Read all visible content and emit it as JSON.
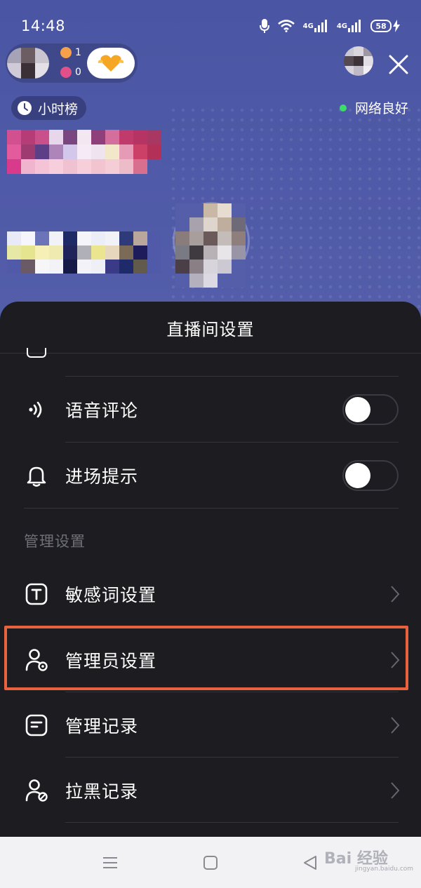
{
  "status_bar": {
    "time": "14:48",
    "network_1": "4G",
    "network_2": "4G",
    "battery": "58"
  },
  "host": {
    "stat_1": "1",
    "stat_2": "0"
  },
  "rank_badge": "小时榜",
  "network_status": "网络良好",
  "sheet": {
    "title": "直播间设置",
    "rows": [
      {
        "label": "语音评论",
        "icon": "voice-icon",
        "toggle": false
      },
      {
        "label": "进场提示",
        "icon": "bell-icon",
        "toggle": false
      }
    ],
    "section_label": "管理设置",
    "manage_items": [
      {
        "label": "敏感词设置",
        "icon": "text-icon"
      },
      {
        "label": "管理员设置",
        "icon": "admin-icon"
      },
      {
        "label": "管理记录",
        "icon": "record-icon"
      },
      {
        "label": "拉黑记录",
        "icon": "block-user-icon"
      }
    ]
  },
  "highlight_color": "#e8623f",
  "watermark": {
    "text": "Bai 经验",
    "sub": "jingyan.baidu.com"
  }
}
